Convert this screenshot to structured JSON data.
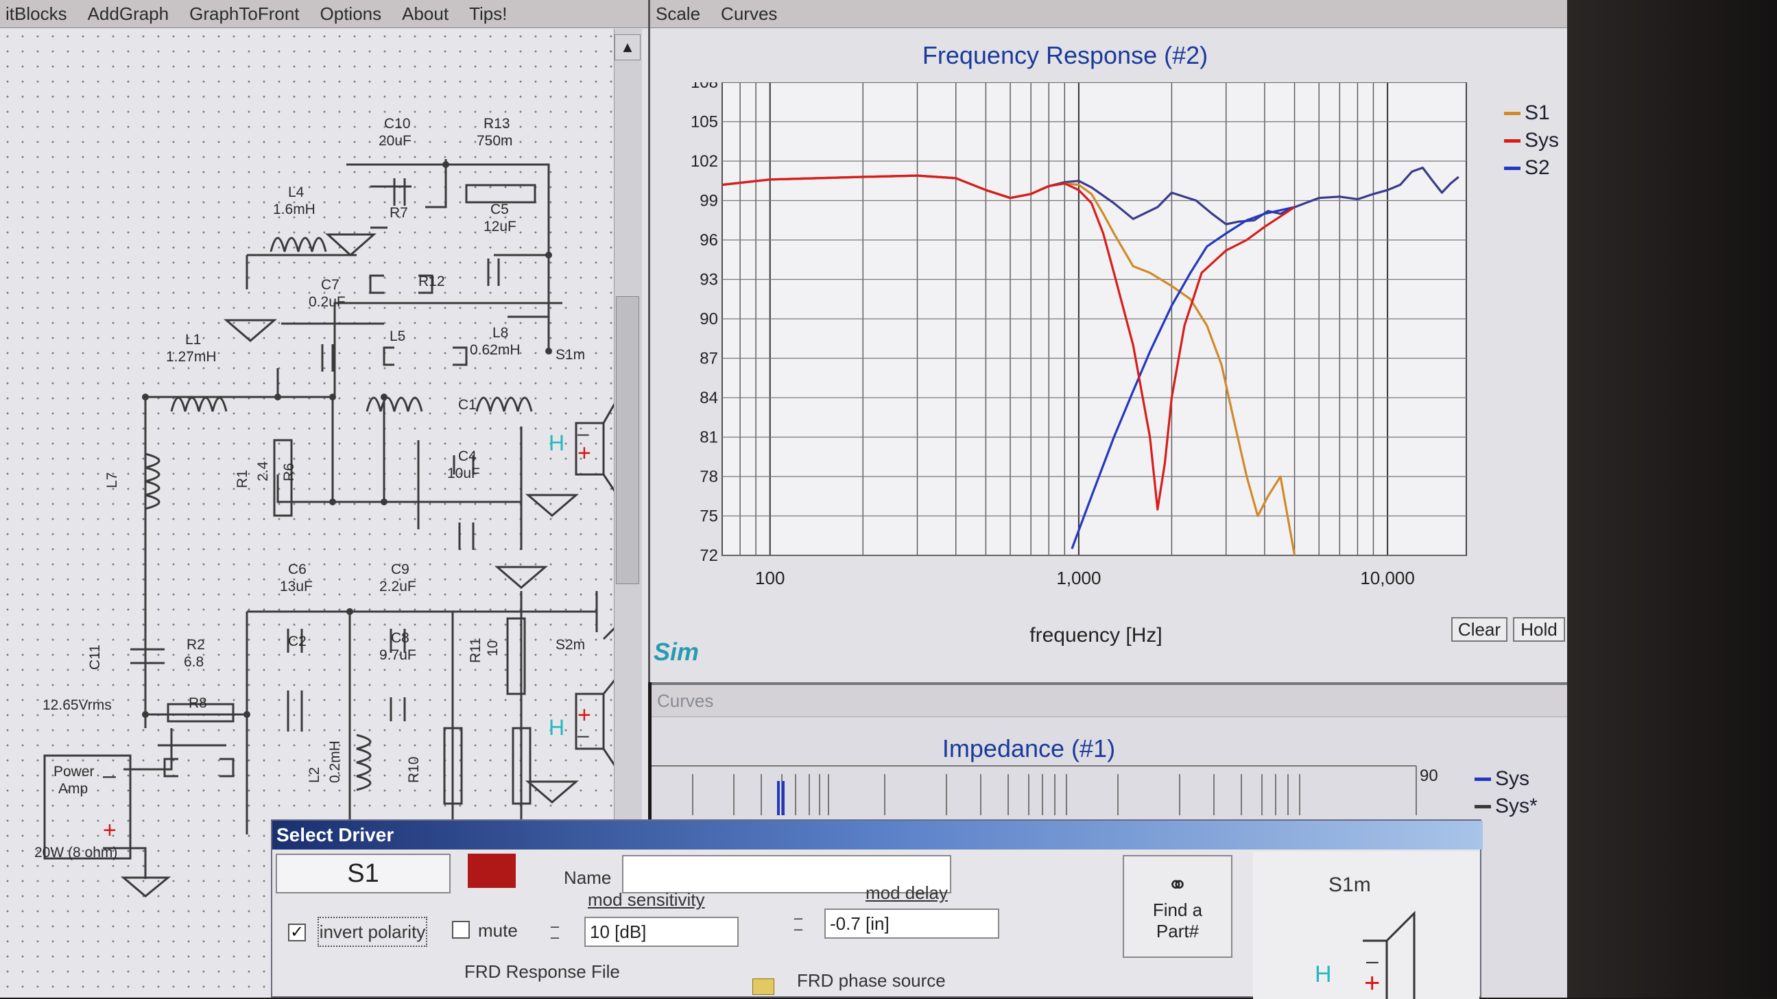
{
  "schematic_window": {
    "menu": [
      "itBlocks",
      "AddGraph",
      "GraphToFront",
      "Options",
      "About",
      "Tips!"
    ],
    "labels": {
      "c10": "C10",
      "c10_val": "20uF",
      "r13": "R13",
      "r13_val": "750m",
      "l4": "L4",
      "l4_val": "1.6mH",
      "r7": "R7",
      "c5": "C5",
      "c5_val": "12uF",
      "c7": "C7",
      "c7_val": "0.2uF",
      "r12": "R12",
      "l1": "L1",
      "l1_val": "1.27mH",
      "l5": "L5",
      "l8": "L8",
      "l8_val": "0.62mH",
      "s1m": "S1m",
      "c1": "C1",
      "l7": "L7",
      "r1": "R1",
      "r1_val": "2.4",
      "r6": "R6",
      "c4": "C4",
      "c4_val": "10uF",
      "c6": "C6",
      "c6_val": "13uF",
      "c9": "C9",
      "c9_val": "2.2uF",
      "c2": "C2",
      "c8": "C8",
      "c8_val": "9.7uF",
      "r11": "R11",
      "r11_val": "10",
      "s2m": "S2m",
      "c11": "C11",
      "r2": "R2",
      "r2_val": "6.8",
      "r8": "R8",
      "l2": "L2",
      "l2_val": "0.2mH",
      "r10": "R10",
      "vrms": "12.65Vrms",
      "amp_line1": "Power",
      "amp_line2": "Amp",
      "amp_rating": "20W (8 ohm)",
      "h": "H"
    }
  },
  "graph_window": {
    "menu": [
      "Scale",
      "Curves"
    ],
    "clear_button": "Clear",
    "hold_button": "Hold",
    "sim_logo": "Sim"
  },
  "chart_data": [
    {
      "type": "line",
      "title": "Frequency Response (#2)",
      "xlabel": "frequency [Hz]",
      "ylabel": "",
      "x_scale": "log",
      "xlim": [
        70,
        18000
      ],
      "ylim": [
        72,
        108
      ],
      "x_tick_labels": [
        "100",
        "1,000",
        "10,000"
      ],
      "x_tick_values": [
        100,
        1000,
        10000
      ],
      "y_ticks": [
        72,
        75,
        78,
        81,
        84,
        87,
        90,
        93,
        96,
        99,
        102,
        105,
        108
      ],
      "grid": true,
      "legend_position": "right",
      "series": [
        {
          "name": "S1",
          "color": "#d08a2a",
          "x": [
            70,
            100,
            200,
            300,
            400,
            500,
            600,
            700,
            800,
            900,
            1000,
            1100,
            1200,
            1300,
            1500,
            1700,
            2000,
            2300,
            2600,
            2900,
            3200,
            3500,
            3800,
            4100,
            4500,
            5000
          ],
          "y": [
            100.2,
            100.6,
            100.8,
            100.9,
            100.7,
            99.8,
            99.2,
            99.5,
            100.1,
            100.3,
            100.2,
            99.5,
            98,
            96.5,
            94,
            93.5,
            92.5,
            91.5,
            89.5,
            86.5,
            82,
            78,
            75,
            76.5,
            78,
            72
          ]
        },
        {
          "name": "Sys",
          "color": "#d81c1c",
          "x": [
            70,
            100,
            200,
            300,
            400,
            500,
            600,
            700,
            800,
            900,
            1000,
            1100,
            1200,
            1300,
            1500,
            1700,
            1800,
            1900,
            2000,
            2200,
            2500,
            3000,
            3500,
            4000,
            5000
          ],
          "y": [
            100.2,
            100.6,
            100.8,
            100.9,
            100.7,
            99.8,
            99.2,
            99.5,
            100.1,
            100.3,
            99.8,
            98.8,
            96.5,
            93.5,
            88,
            81,
            75.5,
            79,
            84,
            89.5,
            93.5,
            95.2,
            96,
            97,
            98.5
          ]
        },
        {
          "name": "S2",
          "color": "#2238c0",
          "x": [
            950,
            1100,
            1300,
            1500,
            1700,
            2000,
            2300,
            2600,
            3000,
            3500,
            4000,
            5000
          ],
          "y": [
            72.5,
            76.5,
            81,
            84.5,
            87.5,
            91,
            93.5,
            95.5,
            96.5,
            97.5,
            98,
            98.5
          ]
        },
        {
          "name": "",
          "color": "#3a3a8a",
          "x": [
            70,
            100,
            200,
            300,
            400,
            500,
            600,
            700,
            800,
            900,
            1000,
            1100,
            1300,
            1500,
            1800,
            2000,
            2400,
            2700,
            3000,
            3300,
            3700,
            4100,
            4500,
            5000,
            6000,
            7000,
            8000,
            9000,
            10000,
            11000,
            12000,
            13000,
            14000,
            15000,
            16000,
            17000
          ],
          "y": [
            100.2,
            100.6,
            100.8,
            100.9,
            100.7,
            99.8,
            99.2,
            99.5,
            100.1,
            100.4,
            100.5,
            100,
            98.8,
            97.6,
            98.5,
            99.6,
            99,
            98,
            97.2,
            97.4,
            97.5,
            98.2,
            98,
            98.5,
            99.2,
            99.3,
            99.1,
            99.5,
            99.8,
            100.2,
            101.2,
            101.5,
            100.5,
            99.6,
            100.3,
            100.8
          ]
        }
      ]
    },
    {
      "type": "line",
      "title": "Impedance (#1)",
      "y_tick_labels": [
        "90"
      ],
      "legend_position": "right",
      "series": [
        {
          "name": "Sys",
          "color": "#2238c0"
        },
        {
          "name": "Sys*",
          "color": "#3a3a3a"
        }
      ]
    }
  ],
  "impedance_window": {
    "menu": [
      "Curves"
    ]
  },
  "driver_dialog": {
    "title": "Select Driver",
    "driver_id": "S1",
    "driver_color": "#b01818",
    "name_label": "Name",
    "name_value": "",
    "invert_label": "invert polarity",
    "invert_checked_glyph": "✓",
    "mute_label": "mute",
    "mod_sensitivity_label": "mod sensitivity",
    "mod_sensitivity_value": "10 [dB]",
    "mod_delay_label": "mod delay",
    "mod_delay_value": "-0.7 [in]",
    "find_part_line1": "Find a",
    "find_part_line2": "Part#",
    "frd_response_label": "FRD Response File",
    "frd_phase_label": "FRD phase source",
    "preview_label": "S1m",
    "preview_h": "H"
  }
}
